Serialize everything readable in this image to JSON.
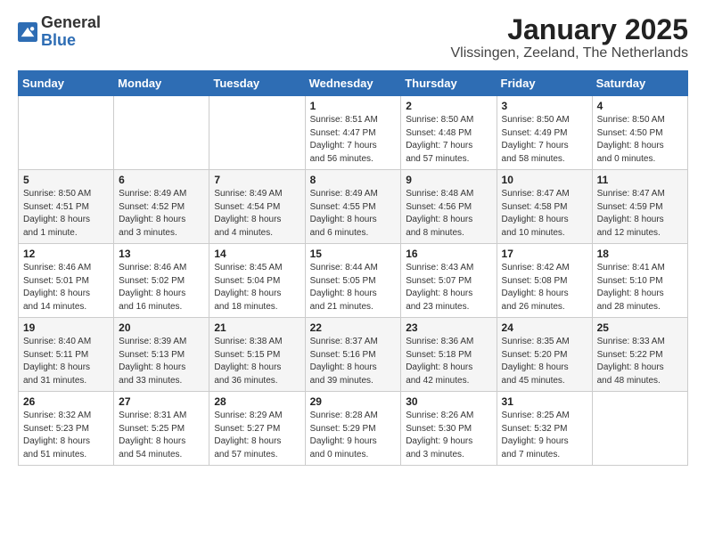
{
  "header": {
    "logo_line1": "General",
    "logo_line2": "Blue",
    "title": "January 2025",
    "subtitle": "Vlissingen, Zeeland, The Netherlands"
  },
  "weekdays": [
    "Sunday",
    "Monday",
    "Tuesday",
    "Wednesday",
    "Thursday",
    "Friday",
    "Saturday"
  ],
  "weeks": [
    [
      {
        "day": "",
        "info": ""
      },
      {
        "day": "",
        "info": ""
      },
      {
        "day": "",
        "info": ""
      },
      {
        "day": "1",
        "info": "Sunrise: 8:51 AM\nSunset: 4:47 PM\nDaylight: 7 hours\nand 56 minutes."
      },
      {
        "day": "2",
        "info": "Sunrise: 8:50 AM\nSunset: 4:48 PM\nDaylight: 7 hours\nand 57 minutes."
      },
      {
        "day": "3",
        "info": "Sunrise: 8:50 AM\nSunset: 4:49 PM\nDaylight: 7 hours\nand 58 minutes."
      },
      {
        "day": "4",
        "info": "Sunrise: 8:50 AM\nSunset: 4:50 PM\nDaylight: 8 hours\nand 0 minutes."
      }
    ],
    [
      {
        "day": "5",
        "info": "Sunrise: 8:50 AM\nSunset: 4:51 PM\nDaylight: 8 hours\nand 1 minute."
      },
      {
        "day": "6",
        "info": "Sunrise: 8:49 AM\nSunset: 4:52 PM\nDaylight: 8 hours\nand 3 minutes."
      },
      {
        "day": "7",
        "info": "Sunrise: 8:49 AM\nSunset: 4:54 PM\nDaylight: 8 hours\nand 4 minutes."
      },
      {
        "day": "8",
        "info": "Sunrise: 8:49 AM\nSunset: 4:55 PM\nDaylight: 8 hours\nand 6 minutes."
      },
      {
        "day": "9",
        "info": "Sunrise: 8:48 AM\nSunset: 4:56 PM\nDaylight: 8 hours\nand 8 minutes."
      },
      {
        "day": "10",
        "info": "Sunrise: 8:47 AM\nSunset: 4:58 PM\nDaylight: 8 hours\nand 10 minutes."
      },
      {
        "day": "11",
        "info": "Sunrise: 8:47 AM\nSunset: 4:59 PM\nDaylight: 8 hours\nand 12 minutes."
      }
    ],
    [
      {
        "day": "12",
        "info": "Sunrise: 8:46 AM\nSunset: 5:01 PM\nDaylight: 8 hours\nand 14 minutes."
      },
      {
        "day": "13",
        "info": "Sunrise: 8:46 AM\nSunset: 5:02 PM\nDaylight: 8 hours\nand 16 minutes."
      },
      {
        "day": "14",
        "info": "Sunrise: 8:45 AM\nSunset: 5:04 PM\nDaylight: 8 hours\nand 18 minutes."
      },
      {
        "day": "15",
        "info": "Sunrise: 8:44 AM\nSunset: 5:05 PM\nDaylight: 8 hours\nand 21 minutes."
      },
      {
        "day": "16",
        "info": "Sunrise: 8:43 AM\nSunset: 5:07 PM\nDaylight: 8 hours\nand 23 minutes."
      },
      {
        "day": "17",
        "info": "Sunrise: 8:42 AM\nSunset: 5:08 PM\nDaylight: 8 hours\nand 26 minutes."
      },
      {
        "day": "18",
        "info": "Sunrise: 8:41 AM\nSunset: 5:10 PM\nDaylight: 8 hours\nand 28 minutes."
      }
    ],
    [
      {
        "day": "19",
        "info": "Sunrise: 8:40 AM\nSunset: 5:11 PM\nDaylight: 8 hours\nand 31 minutes."
      },
      {
        "day": "20",
        "info": "Sunrise: 8:39 AM\nSunset: 5:13 PM\nDaylight: 8 hours\nand 33 minutes."
      },
      {
        "day": "21",
        "info": "Sunrise: 8:38 AM\nSunset: 5:15 PM\nDaylight: 8 hours\nand 36 minutes."
      },
      {
        "day": "22",
        "info": "Sunrise: 8:37 AM\nSunset: 5:16 PM\nDaylight: 8 hours\nand 39 minutes."
      },
      {
        "day": "23",
        "info": "Sunrise: 8:36 AM\nSunset: 5:18 PM\nDaylight: 8 hours\nand 42 minutes."
      },
      {
        "day": "24",
        "info": "Sunrise: 8:35 AM\nSunset: 5:20 PM\nDaylight: 8 hours\nand 45 minutes."
      },
      {
        "day": "25",
        "info": "Sunrise: 8:33 AM\nSunset: 5:22 PM\nDaylight: 8 hours\nand 48 minutes."
      }
    ],
    [
      {
        "day": "26",
        "info": "Sunrise: 8:32 AM\nSunset: 5:23 PM\nDaylight: 8 hours\nand 51 minutes."
      },
      {
        "day": "27",
        "info": "Sunrise: 8:31 AM\nSunset: 5:25 PM\nDaylight: 8 hours\nand 54 minutes."
      },
      {
        "day": "28",
        "info": "Sunrise: 8:29 AM\nSunset: 5:27 PM\nDaylight: 8 hours\nand 57 minutes."
      },
      {
        "day": "29",
        "info": "Sunrise: 8:28 AM\nSunset: 5:29 PM\nDaylight: 9 hours\nand 0 minutes."
      },
      {
        "day": "30",
        "info": "Sunrise: 8:26 AM\nSunset: 5:30 PM\nDaylight: 9 hours\nand 3 minutes."
      },
      {
        "day": "31",
        "info": "Sunrise: 8:25 AM\nSunset: 5:32 PM\nDaylight: 9 hours\nand 7 minutes."
      },
      {
        "day": "",
        "info": ""
      }
    ]
  ]
}
